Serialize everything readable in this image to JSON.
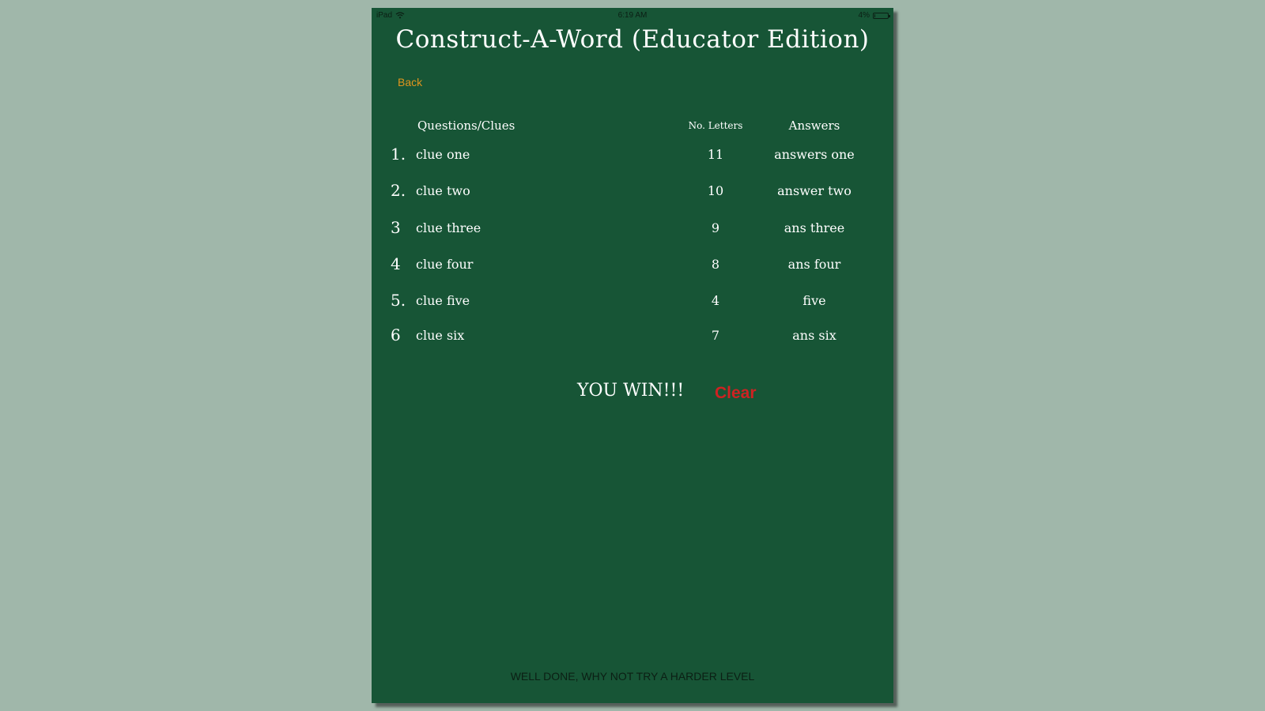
{
  "status_bar": {
    "device": "iPad",
    "time": "6:19 AM",
    "battery": "4%",
    "battery_level": 0.04
  },
  "title": "Construct-A-Word (Educator Edition)",
  "back_label": "Back",
  "headers": {
    "clues": "Questions/Clues",
    "letters": "No. Letters",
    "answers": "Answers"
  },
  "rows": [
    {
      "num": "1.",
      "clue": "clue one",
      "letters": "11",
      "answer": "answers one"
    },
    {
      "num": "2.",
      "clue": "clue two",
      "letters": "10",
      "answer": "answer two"
    },
    {
      "num": "3",
      "clue": "clue three",
      "letters": "9",
      "answer": "ans three"
    },
    {
      "num": "4",
      "clue": "clue four",
      "letters": "8",
      "answer": "ans four"
    },
    {
      "num": "5.",
      "clue": "clue five",
      "letters": "4",
      "answer": "five"
    },
    {
      "num": "6",
      "clue": "clue six",
      "letters": "7",
      "answer": "ans six"
    }
  ],
  "win_text": "YOU WIN!!!",
  "clear_label": "Clear",
  "footer_message": "WELL DONE, WHY NOT TRY A HARDER LEVEL",
  "colors": {
    "board": "#175536",
    "background": "#a0b7aa",
    "back_link": "#e0951e",
    "clear": "#ce2222"
  }
}
